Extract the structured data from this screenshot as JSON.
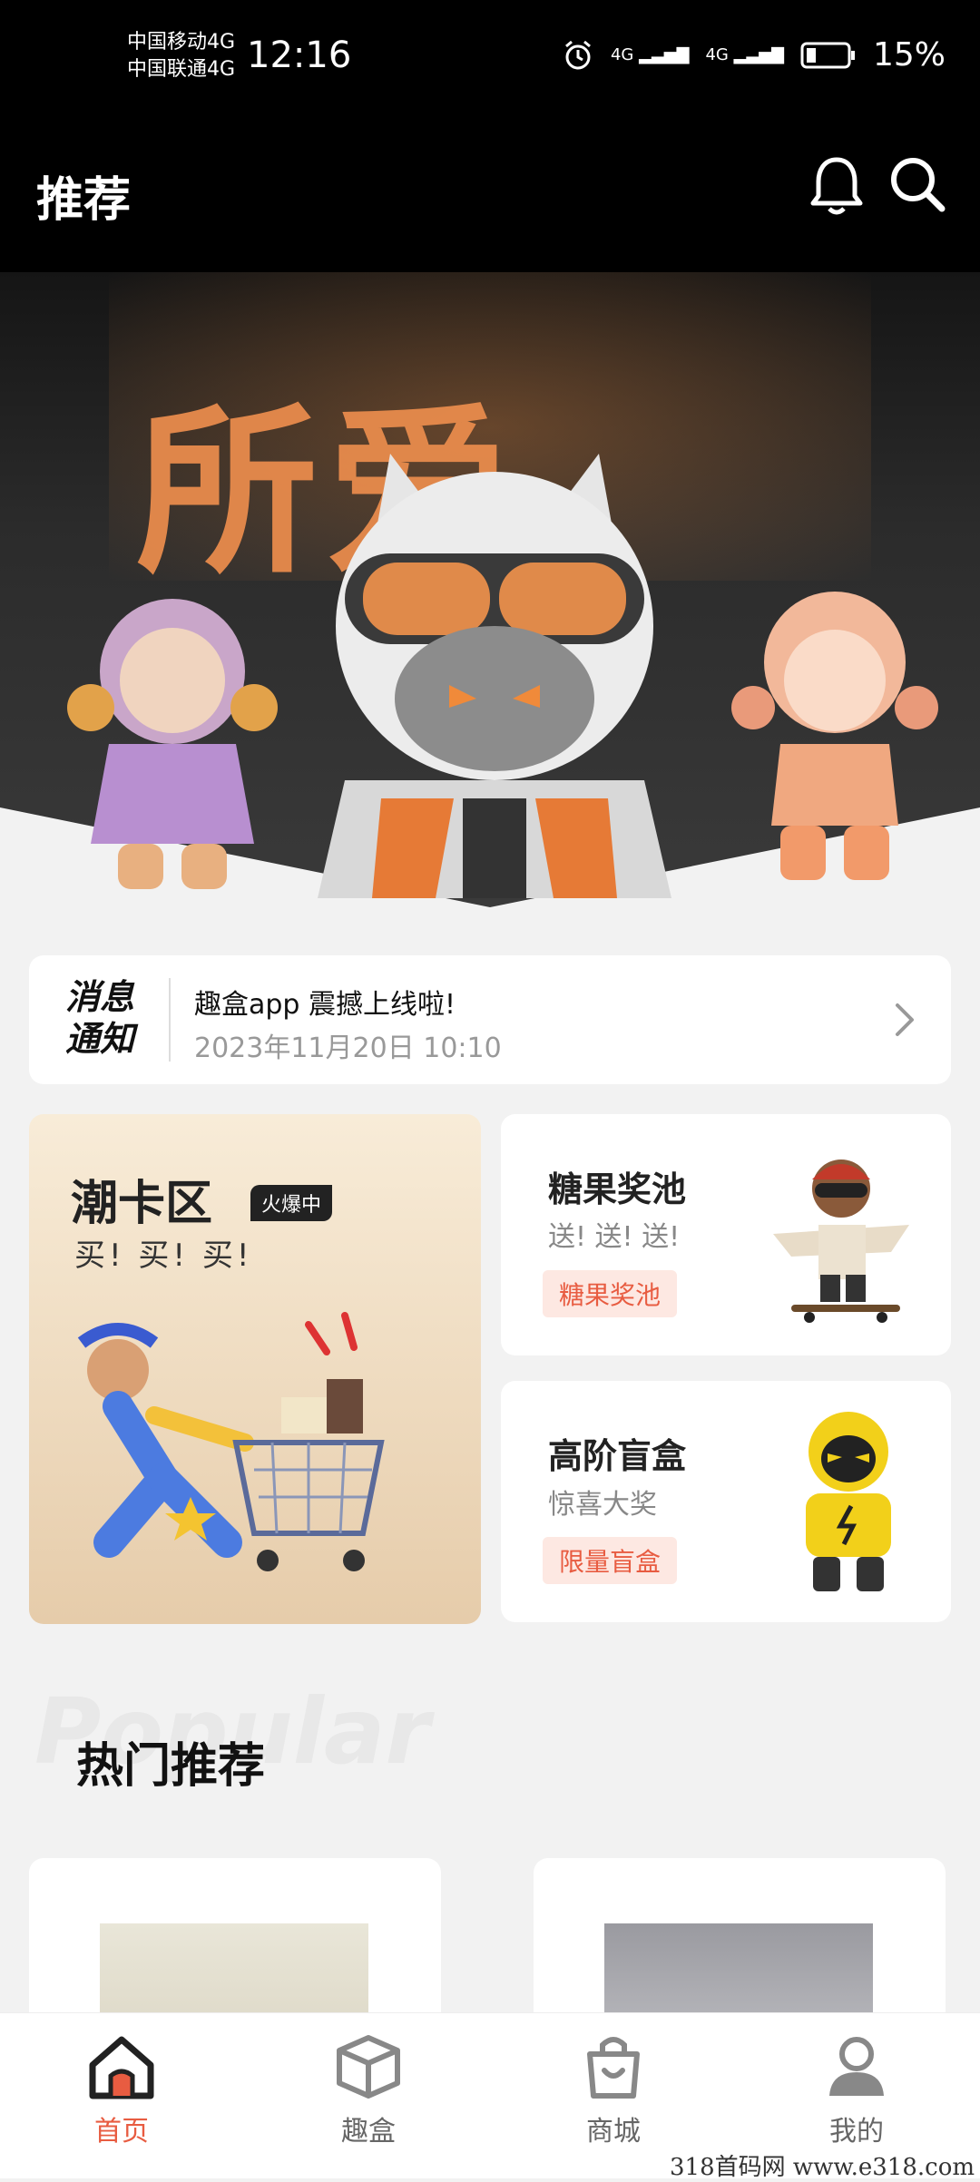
{
  "status_bar": {
    "carrier_1": "中国移动4G",
    "carrier_2": "中国联通4G",
    "time": "12:16",
    "signal_1": "4G",
    "signal_2": "4G",
    "battery": "15%"
  },
  "header": {
    "title": "推荐"
  },
  "banner": {
    "text": "所爱"
  },
  "notice": {
    "label_line1": "消息",
    "label_line2": "通知",
    "title": "趣盒app 震撼上线啦!",
    "date": "2023年11月20日 10:10"
  },
  "cards": {
    "chao": {
      "title": "潮卡区",
      "badge": "火爆中",
      "subtitle": "买! 买! 买!"
    },
    "candy": {
      "title": "糖果奖池",
      "subtitle": "送! 送! 送!",
      "tag": "糖果奖池"
    },
    "box": {
      "title": "高阶盲盒",
      "subtitle": "惊喜大奖",
      "tag": "限量盲盒"
    }
  },
  "popular": {
    "bg_text": "Popular",
    "title": "热门推荐"
  },
  "nav": {
    "items": [
      {
        "label": "首页",
        "icon": "home-icon",
        "active": true
      },
      {
        "label": "趣盒",
        "icon": "box-icon",
        "active": false
      },
      {
        "label": "商城",
        "icon": "shopping-bag-icon",
        "active": false
      },
      {
        "label": "我的",
        "icon": "profile-icon",
        "active": false
      }
    ]
  },
  "watermark": "318首码网  www.e318.com",
  "colors": {
    "accent": "#e85c41",
    "banner_orange": "#e88b4c"
  }
}
